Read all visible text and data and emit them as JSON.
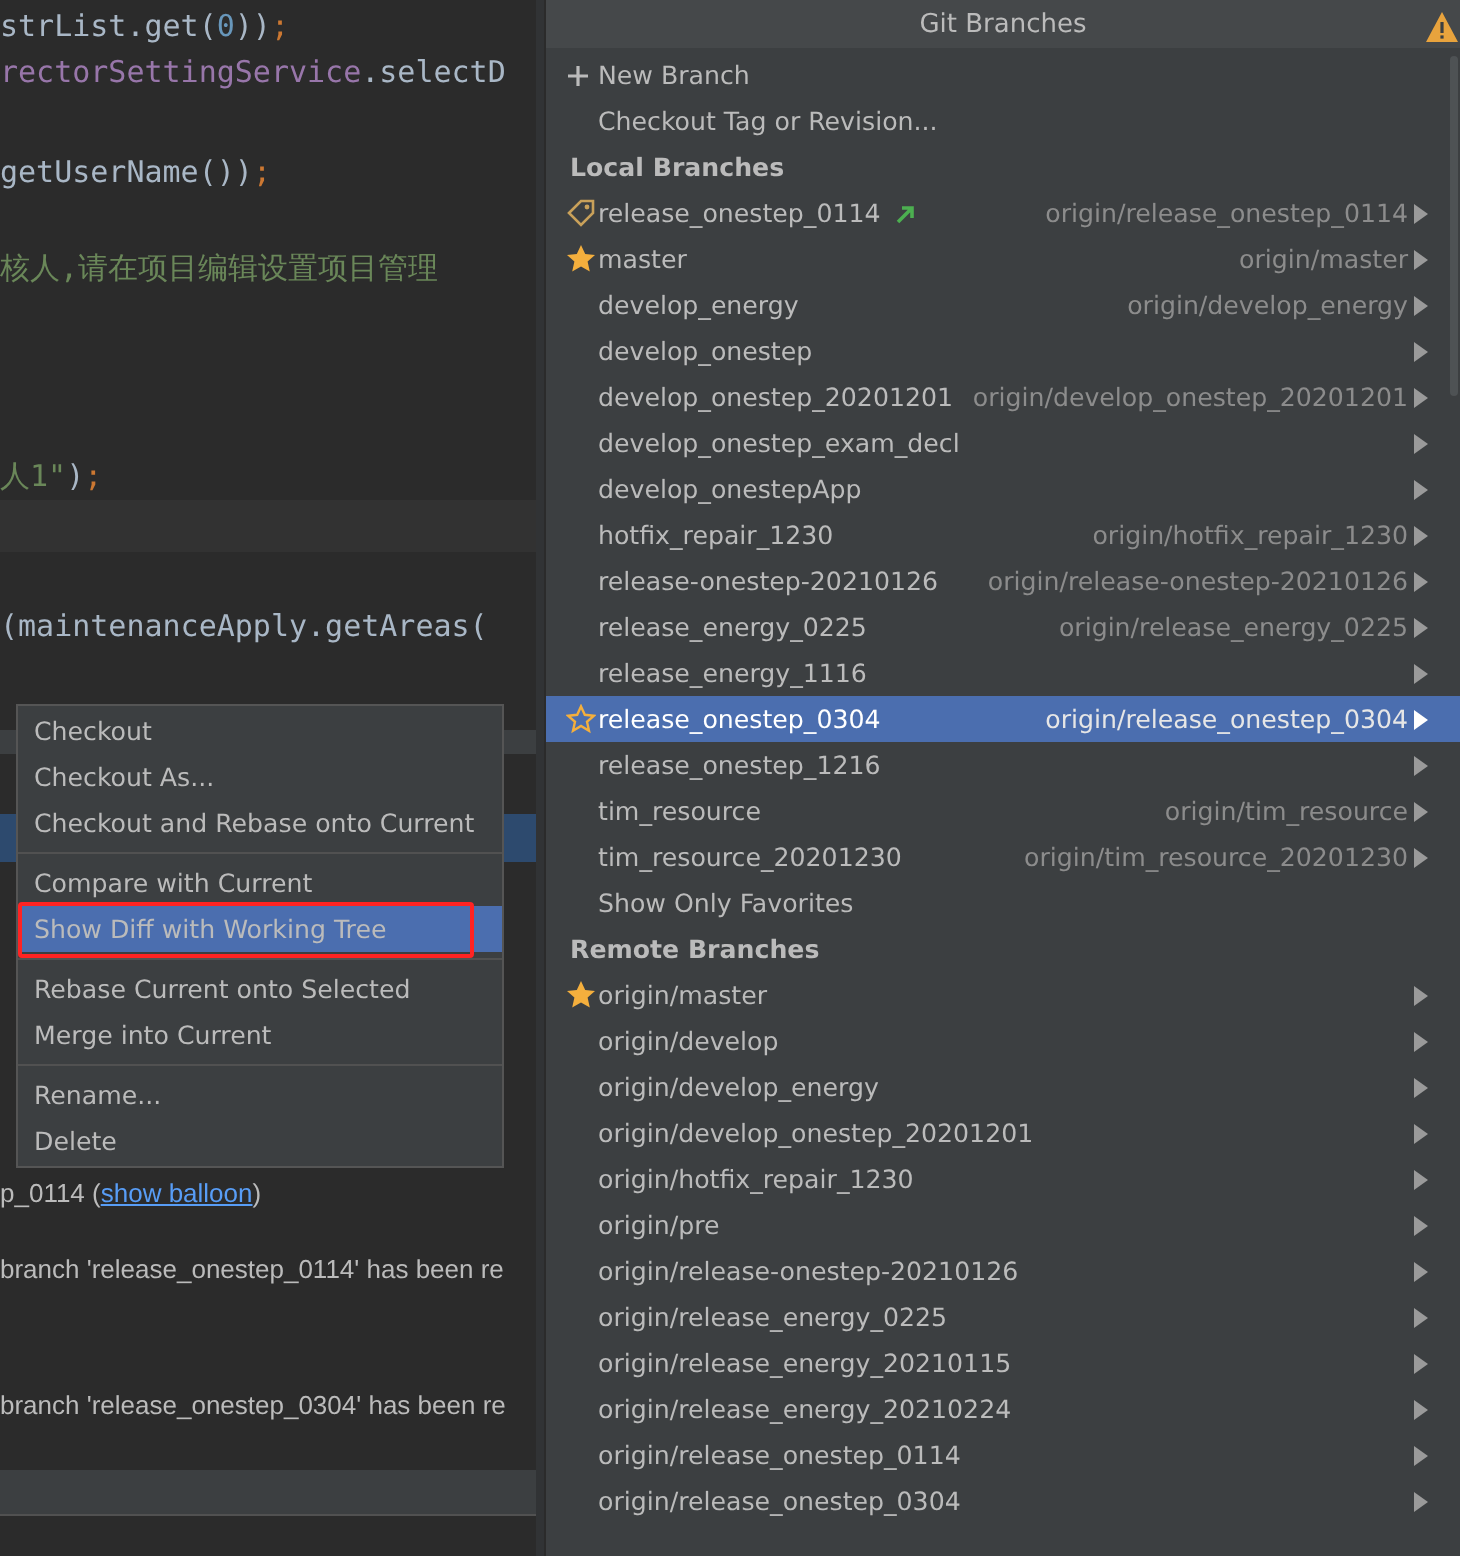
{
  "editor": {
    "lines": [
      {
        "segments": [
          {
            "text": "strList.get(",
            "kind": "plain"
          },
          {
            "text": "0",
            "kind": "number"
          },
          {
            "text": "))",
            "kind": "plain"
          },
          {
            "text": ";",
            "kind": "keyword"
          }
        ]
      },
      {
        "segments": [
          {
            "text": "rectorSettingService",
            "kind": "field"
          },
          {
            "text": ".selectD",
            "kind": "plain"
          }
        ]
      },
      {
        "segments": [
          {
            "text": "getUserName())",
            "kind": "plain"
          },
          {
            "text": ";",
            "kind": "keyword"
          }
        ]
      },
      {
        "segments": [
          {
            "text": "核人,请在项目编辑设置项目管理",
            "kind": "string"
          }
        ]
      },
      {
        "segments": [
          {
            "text": "人1\"",
            "kind": "string"
          },
          {
            "text": ")",
            "kind": "plain"
          },
          {
            "text": ";",
            "kind": "keyword"
          }
        ]
      },
      {
        "segments": [
          {
            "text": "(maintenanceApply.getAreas(",
            "kind": "plain"
          }
        ]
      }
    ]
  },
  "event_log": {
    "lines": [
      {
        "segments": [
          {
            "text": "p_0114 (",
            "kind": "text"
          },
          {
            "text": "show balloon",
            "kind": "link"
          },
          {
            "text": ")",
            "kind": "text"
          }
        ]
      },
      {
        "segments": [
          {
            "text": "branch 'release_onestep_0114' has been re",
            "kind": "text"
          }
        ]
      },
      {
        "segments": [
          {
            "text": "branch 'release_onestep_0304' has been re",
            "kind": "text"
          }
        ]
      }
    ]
  },
  "branches_popup": {
    "title": "Git Branches",
    "actions": [
      {
        "label": "New Branch",
        "kind": "add"
      },
      {
        "label": "Checkout Tag or Revision...",
        "kind": "plain"
      }
    ],
    "sections": [
      {
        "heading": "Local Branches",
        "branches": [
          {
            "name": "release_onestep_0114",
            "remote": "origin/release_onestep_0114",
            "kind": "tag",
            "outgoing": true,
            "selected": false
          },
          {
            "name": "master",
            "remote": "origin/master",
            "kind": "favorite",
            "outgoing": false,
            "selected": false
          },
          {
            "name": "develop_energy",
            "remote": "origin/develop_energy",
            "kind": "plain",
            "outgoing": false,
            "selected": false
          },
          {
            "name": "develop_onestep",
            "kind": "plain",
            "outgoing": false,
            "selected": false
          },
          {
            "name": "develop_onestep_20201201",
            "remote": "origin/develop_onestep_20201201",
            "kind": "plain",
            "outgoing": false,
            "selected": false
          },
          {
            "name": "develop_onestep_exam_decl",
            "kind": "plain",
            "outgoing": false,
            "selected": false
          },
          {
            "name": "develop_onestepApp",
            "kind": "plain",
            "outgoing": false,
            "selected": false
          },
          {
            "name": "hotfix_repair_1230",
            "remote": "origin/hotfix_repair_1230",
            "kind": "plain",
            "outgoing": false,
            "selected": false
          },
          {
            "name": "release-onestep-20210126",
            "remote": "origin/release-onestep-20210126",
            "kind": "plain",
            "outgoing": false,
            "selected": false
          },
          {
            "name": "release_energy_0225",
            "remote": "origin/release_energy_0225",
            "kind": "plain",
            "outgoing": false,
            "selected": false
          },
          {
            "name": "release_energy_1116",
            "kind": "plain",
            "outgoing": false,
            "selected": false
          },
          {
            "name": "release_onestep_0304",
            "remote": "origin/release_onestep_0304",
            "kind": "favorite-hover",
            "outgoing": false,
            "selected": true
          },
          {
            "name": "release_onestep_1216",
            "kind": "plain",
            "outgoing": false,
            "selected": false
          },
          {
            "name": "tim_resource",
            "remote": "origin/tim_resource",
            "kind": "plain",
            "outgoing": false,
            "selected": false
          },
          {
            "name": "tim_resource_20201230",
            "remote": "origin/tim_resource_20201230",
            "kind": "plain",
            "outgoing": false,
            "selected": false
          }
        ],
        "footer": "Show Only Favorites"
      },
      {
        "heading": "Remote Branches",
        "branches": [
          {
            "name": "origin/master",
            "kind": "favorite",
            "selected": false
          },
          {
            "name": "origin/develop",
            "kind": "plain",
            "selected": false
          },
          {
            "name": "origin/develop_energy",
            "kind": "plain",
            "selected": false
          },
          {
            "name": "origin/develop_onestep_20201201",
            "kind": "plain",
            "selected": false
          },
          {
            "name": "origin/hotfix_repair_1230",
            "kind": "plain",
            "selected": false
          },
          {
            "name": "origin/pre",
            "kind": "plain",
            "selected": false
          },
          {
            "name": "origin/release-onestep-20210126",
            "kind": "plain",
            "selected": false
          },
          {
            "name": "origin/release_energy_0225",
            "kind": "plain",
            "selected": false
          },
          {
            "name": "origin/release_energy_20210115",
            "kind": "plain",
            "selected": false
          },
          {
            "name": "origin/release_energy_20210224",
            "kind": "plain",
            "selected": false
          },
          {
            "name": "origin/release_onestep_0114",
            "kind": "plain",
            "selected": false
          },
          {
            "name": "origin/release_onestep_0304",
            "kind": "plain",
            "selected": false
          }
        ]
      }
    ]
  },
  "context_menu": {
    "groups": [
      [
        {
          "label": "Checkout",
          "selected": false,
          "boxed": false
        },
        {
          "label": "Checkout As...",
          "selected": false,
          "boxed": false
        },
        {
          "label": "Checkout and Rebase onto Current",
          "selected": false,
          "boxed": false
        }
      ],
      [
        {
          "label": "Compare with Current",
          "selected": false,
          "boxed": false
        },
        {
          "label": "Show Diff with Working Tree",
          "selected": true,
          "boxed": true
        }
      ],
      [
        {
          "label": "Rebase Current onto Selected",
          "selected": false,
          "boxed": false
        },
        {
          "label": "Merge into Current",
          "selected": false,
          "boxed": false
        }
      ],
      [
        {
          "label": "Rename...",
          "selected": false,
          "boxed": false
        },
        {
          "label": "Delete",
          "selected": false,
          "boxed": false
        }
      ]
    ]
  }
}
